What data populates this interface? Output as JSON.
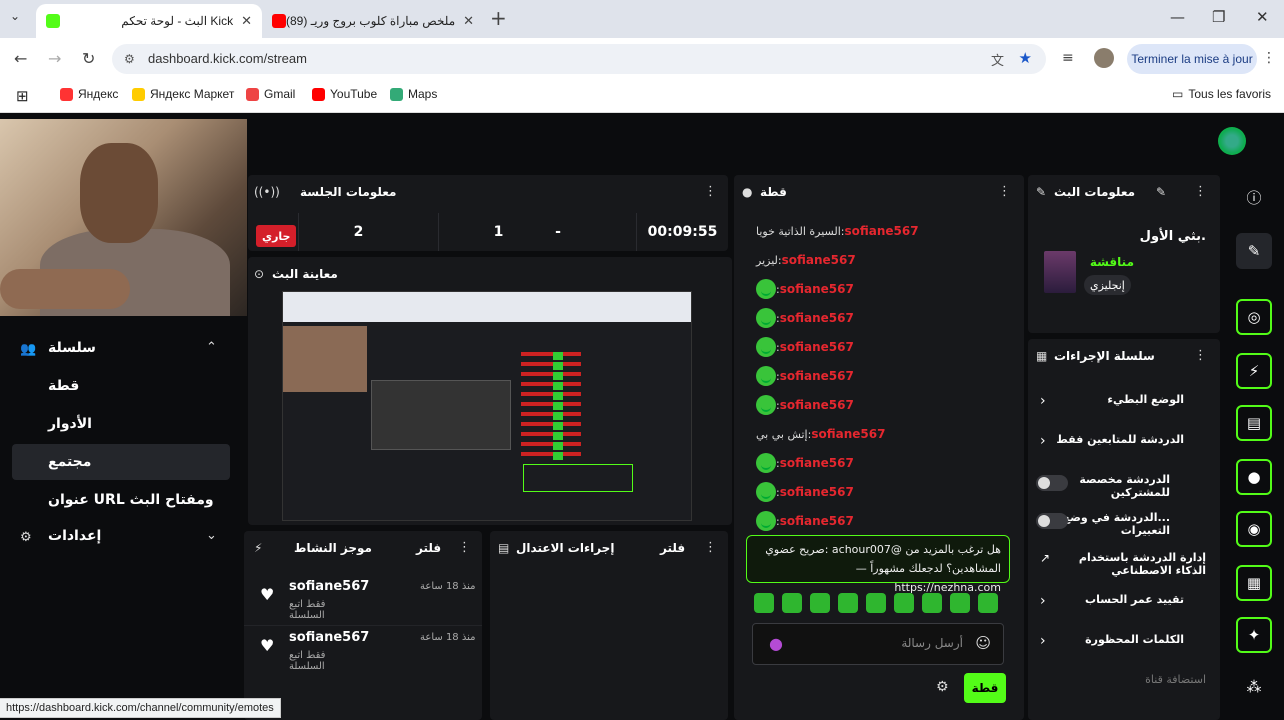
{
  "browser": {
    "tabs": [
      {
        "title": "البث - لوحة تحكم Kick",
        "close": "✕"
      },
      {
        "title": "(89) ملخص مباراة كلوب بروج وريـ",
        "close": "✕"
      }
    ],
    "new_tab": "+",
    "url": "dashboard.kick.com/stream",
    "update_button": "Terminer la mise à jour",
    "bookmarks": [
      "Яндекс",
      "Яндекс Маркет",
      "Gmail",
      "YouTube",
      "Maps"
    ],
    "all_bookmarks": "Tous les favoris",
    "status_url": "https://dashboard.kick.com/channel/community/emotes"
  },
  "colors": {
    "accent": "#53fc18",
    "live": "#d41f2a",
    "username": "#e5272f"
  },
  "sidebar": {
    "section": "سلسلة",
    "items": [
      "قطة",
      "الأدوار",
      "مجتمع",
      "عنوان URL ومفتاح البث"
    ],
    "settings": "إعدادات"
  },
  "session": {
    "title": "معلومات الجلسة",
    "status": "جاري",
    "stats": [
      "2",
      "1",
      "-"
    ],
    "uptime": "00:09:55"
  },
  "preview": {
    "title": "معاينة البث"
  },
  "activity": {
    "title": "موجز النشاط",
    "filter": "فلتر",
    "items": [
      {
        "user": "sofiane567",
        "action": "فقط اتبع السلسلة",
        "time": "منذ 18 ساعة"
      },
      {
        "user": "sofiane567",
        "action": "فقط اتبع السلسلة",
        "time": "منذ 18 ساعة"
      }
    ]
  },
  "moderation": {
    "title": "إجراءات الاعتدال",
    "filter": "فلتر"
  },
  "chat": {
    "title": "قطة",
    "messages": [
      {
        "user": "sofiane567",
        "text": "السيرة الذاتية خويا",
        "emote": false
      },
      {
        "user": "sofiane567",
        "text": "ليزير",
        "emote": false
      },
      {
        "user": "sofiane567",
        "text": "",
        "emote": true
      },
      {
        "user": "sofiane567",
        "text": "",
        "emote": true
      },
      {
        "user": "sofiane567",
        "text": "",
        "emote": true
      },
      {
        "user": "sofiane567",
        "text": "",
        "emote": true
      },
      {
        "user": "sofiane567",
        "text": "",
        "emote": true
      },
      {
        "user": "sofiane567",
        "text": "إتش بي بي",
        "emote": false
      },
      {
        "user": "sofiane567",
        "text": "",
        "emote": true
      },
      {
        "user": "sofiane567",
        "text": "",
        "emote": true
      },
      {
        "user": "sofiane567",
        "text": "",
        "emote": true
      }
    ],
    "pinned_line1": "هل ترغب بالمزيد من @achour007 :صريح عضوي",
    "pinned_line2": "المشاهدين؟ لدجعلك مشهوراً — https://nezhna.com",
    "input_placeholder": "أرسل رسالة",
    "send_button": "قطة"
  },
  "stream_info": {
    "title": "معلومات البث",
    "stream_title": "بثي الأول.",
    "category": "مناقشة",
    "language": "إنجليزي"
  },
  "action_chain": {
    "title": "سلسلة الإجراءات",
    "items": [
      {
        "label": "الوضع البطيء",
        "type": "chevron"
      },
      {
        "label": "الدردشة للمتابعين فقط",
        "type": "chevron"
      },
      {
        "label": "الدردشة مخصصة للمشتركين",
        "type": "toggle"
      },
      {
        "label": "...الدردشة في وضع التعبيرات",
        "type": "toggle"
      },
      {
        "label": "إدارة الدردشة باستخدام الذكاء الاصطناعي",
        "type": "external"
      },
      {
        "label": "تقييد عمر الحساب",
        "type": "chevron"
      },
      {
        "label": "الكلمات المحظورة",
        "type": "chevron"
      },
      {
        "label": "استضافة قناة",
        "type": "dim"
      }
    ]
  }
}
